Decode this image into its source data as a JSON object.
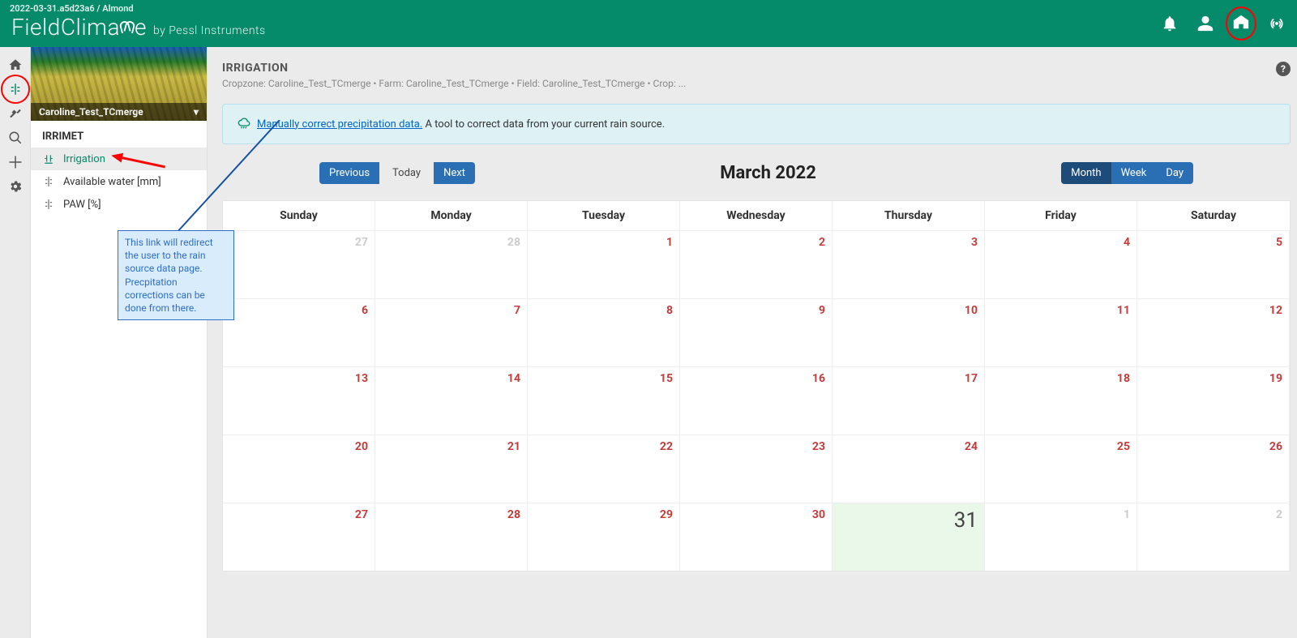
{
  "header": {
    "meta": "2022-03-31.a5d23a6 / Almond",
    "logo_a": "FieldClima",
    "logo_b": "e",
    "by": "by Pessl Instruments"
  },
  "sidepanel": {
    "hero_caption": "Caroline_Test_TCmerge",
    "section": "IRRIMET",
    "items": [
      {
        "label": "Irrigation"
      },
      {
        "label": "Available water [mm]"
      },
      {
        "label": "PAW [%]"
      }
    ]
  },
  "page": {
    "title": "IRRIGATION",
    "crumbs": "Cropzone: Caroline_Test_TCmerge • Farm: Caroline_Test_TCmerge • Field: Caroline_Test_TCmerge • Crop: ...",
    "info_link": "Manually correct precipitation data.",
    "info_tail": " A tool to correct data from your current rain source."
  },
  "toolbar": {
    "prev": "Previous",
    "today": "Today",
    "next": "Next",
    "title": "March 2022",
    "month": "Month",
    "week": "Week",
    "day": "Day"
  },
  "weekdays": [
    "Sunday",
    "Monday",
    "Tuesday",
    "Wednesday",
    "Thursday",
    "Friday",
    "Saturday"
  ],
  "cells": [
    {
      "n": "27",
      "dim": true
    },
    {
      "n": "28",
      "dim": true
    },
    {
      "n": "1"
    },
    {
      "n": "2"
    },
    {
      "n": "3"
    },
    {
      "n": "4"
    },
    {
      "n": "5"
    },
    {
      "n": "6"
    },
    {
      "n": "7"
    },
    {
      "n": "8"
    },
    {
      "n": "9"
    },
    {
      "n": "10"
    },
    {
      "n": "11"
    },
    {
      "n": "12"
    },
    {
      "n": "13"
    },
    {
      "n": "14"
    },
    {
      "n": "15"
    },
    {
      "n": "16"
    },
    {
      "n": "17"
    },
    {
      "n": "18"
    },
    {
      "n": "19"
    },
    {
      "n": "20"
    },
    {
      "n": "21"
    },
    {
      "n": "22"
    },
    {
      "n": "23"
    },
    {
      "n": "24"
    },
    {
      "n": "25"
    },
    {
      "n": "26"
    },
    {
      "n": "27"
    },
    {
      "n": "28"
    },
    {
      "n": "29"
    },
    {
      "n": "30"
    },
    {
      "n": "31",
      "today": true
    },
    {
      "n": "1",
      "dim": true
    },
    {
      "n": "2",
      "dim": true
    }
  ],
  "note": "This link will redirect the user to the rain source data page. Precpitation corrections can be done from there."
}
